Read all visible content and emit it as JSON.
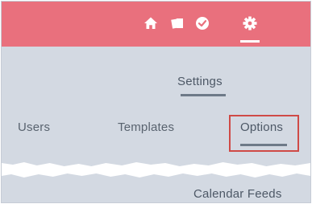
{
  "header": {
    "bar_color": "#e9707d",
    "icons": [
      {
        "name": "home-icon",
        "active": false
      },
      {
        "name": "documents-icon",
        "active": false
      },
      {
        "name": "check-circle-icon",
        "active": false
      },
      {
        "name": "gear-icon",
        "active": true
      }
    ]
  },
  "page": {
    "title": "Settings"
  },
  "tabs": [
    {
      "label": "Users",
      "active": false
    },
    {
      "label": "Templates",
      "active": false
    },
    {
      "label": "Options",
      "active": true,
      "highlighted": true
    }
  ],
  "highlight_color": "#cf4a46",
  "section": {
    "label": "Calendar Feeds"
  }
}
